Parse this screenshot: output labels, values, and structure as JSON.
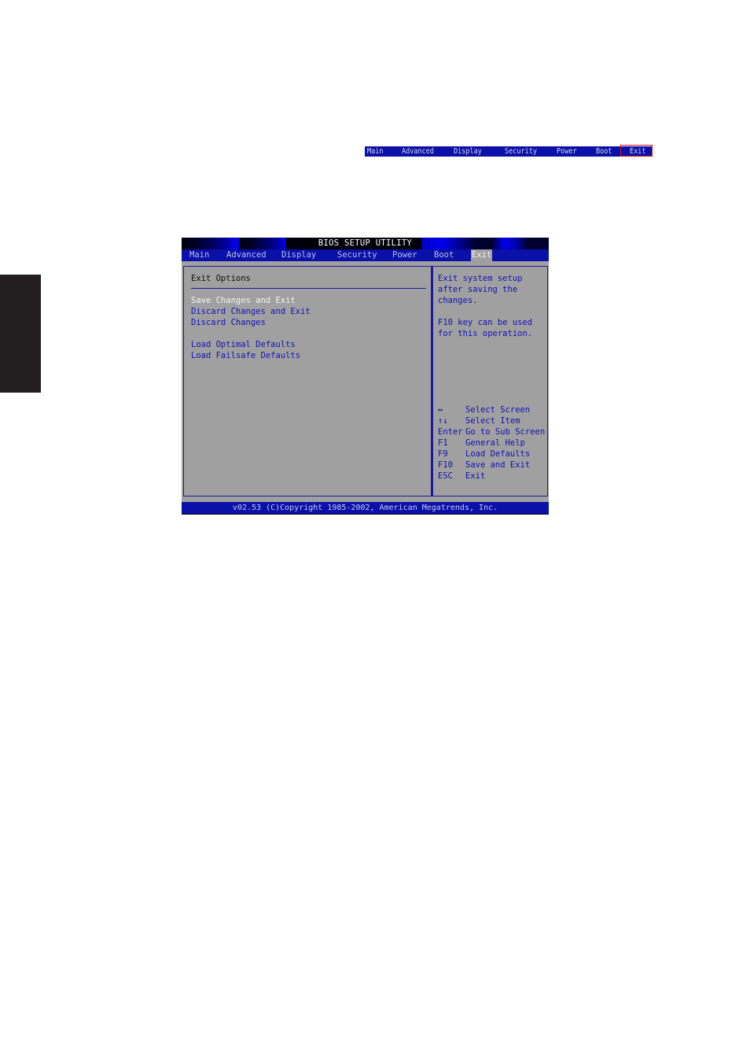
{
  "mini_menu": {
    "items": [
      "Main",
      "Advanced",
      "Display",
      "Security",
      "Power",
      "Boot",
      "Exit"
    ],
    "highlighted": "Exit",
    "highlight_color": "#e01010"
  },
  "bios": {
    "title": "BIOS SETUP UTILITY",
    "menu": [
      "Main",
      "Advanced",
      "Display",
      "Security",
      "Power",
      "Boot",
      "Exit"
    ],
    "active_menu": "Exit",
    "section_title": "Exit Options",
    "options": [
      {
        "label": "Save Changes and Exit",
        "selected": true
      },
      {
        "label": "Discard Changes and Exit",
        "selected": false
      },
      {
        "label": "Discard Changes",
        "selected": false
      },
      {
        "label": "Load Optimal Defaults",
        "selected": false
      },
      {
        "label": "Load Failsafe Defaults",
        "selected": false
      }
    ],
    "help": {
      "lines1": [
        "Exit system setup",
        "after saving the",
        "changes."
      ],
      "lines2": [
        "F10 key can be used",
        "for this operation."
      ]
    },
    "keys": [
      {
        "key": "↔",
        "action": "Select Screen"
      },
      {
        "key": "↑↓",
        "action": "Select Item"
      },
      {
        "key": "Enter",
        "action": "Go to Sub Screen"
      },
      {
        "key": "F1",
        "action": "General Help"
      },
      {
        "key": "F9",
        "action": "Load Defaults"
      },
      {
        "key": "F10",
        "action": "Save and Exit"
      },
      {
        "key": "ESC",
        "action": "Exit"
      }
    ],
    "footer": "v02.53 (C)Copyright 1985-2002, American Megatrends, Inc.",
    "colors": {
      "bar": "#0a10a8",
      "panel": "#a0a0a0",
      "text": "#1010b8",
      "selected_text": "#f4f4f4"
    }
  }
}
